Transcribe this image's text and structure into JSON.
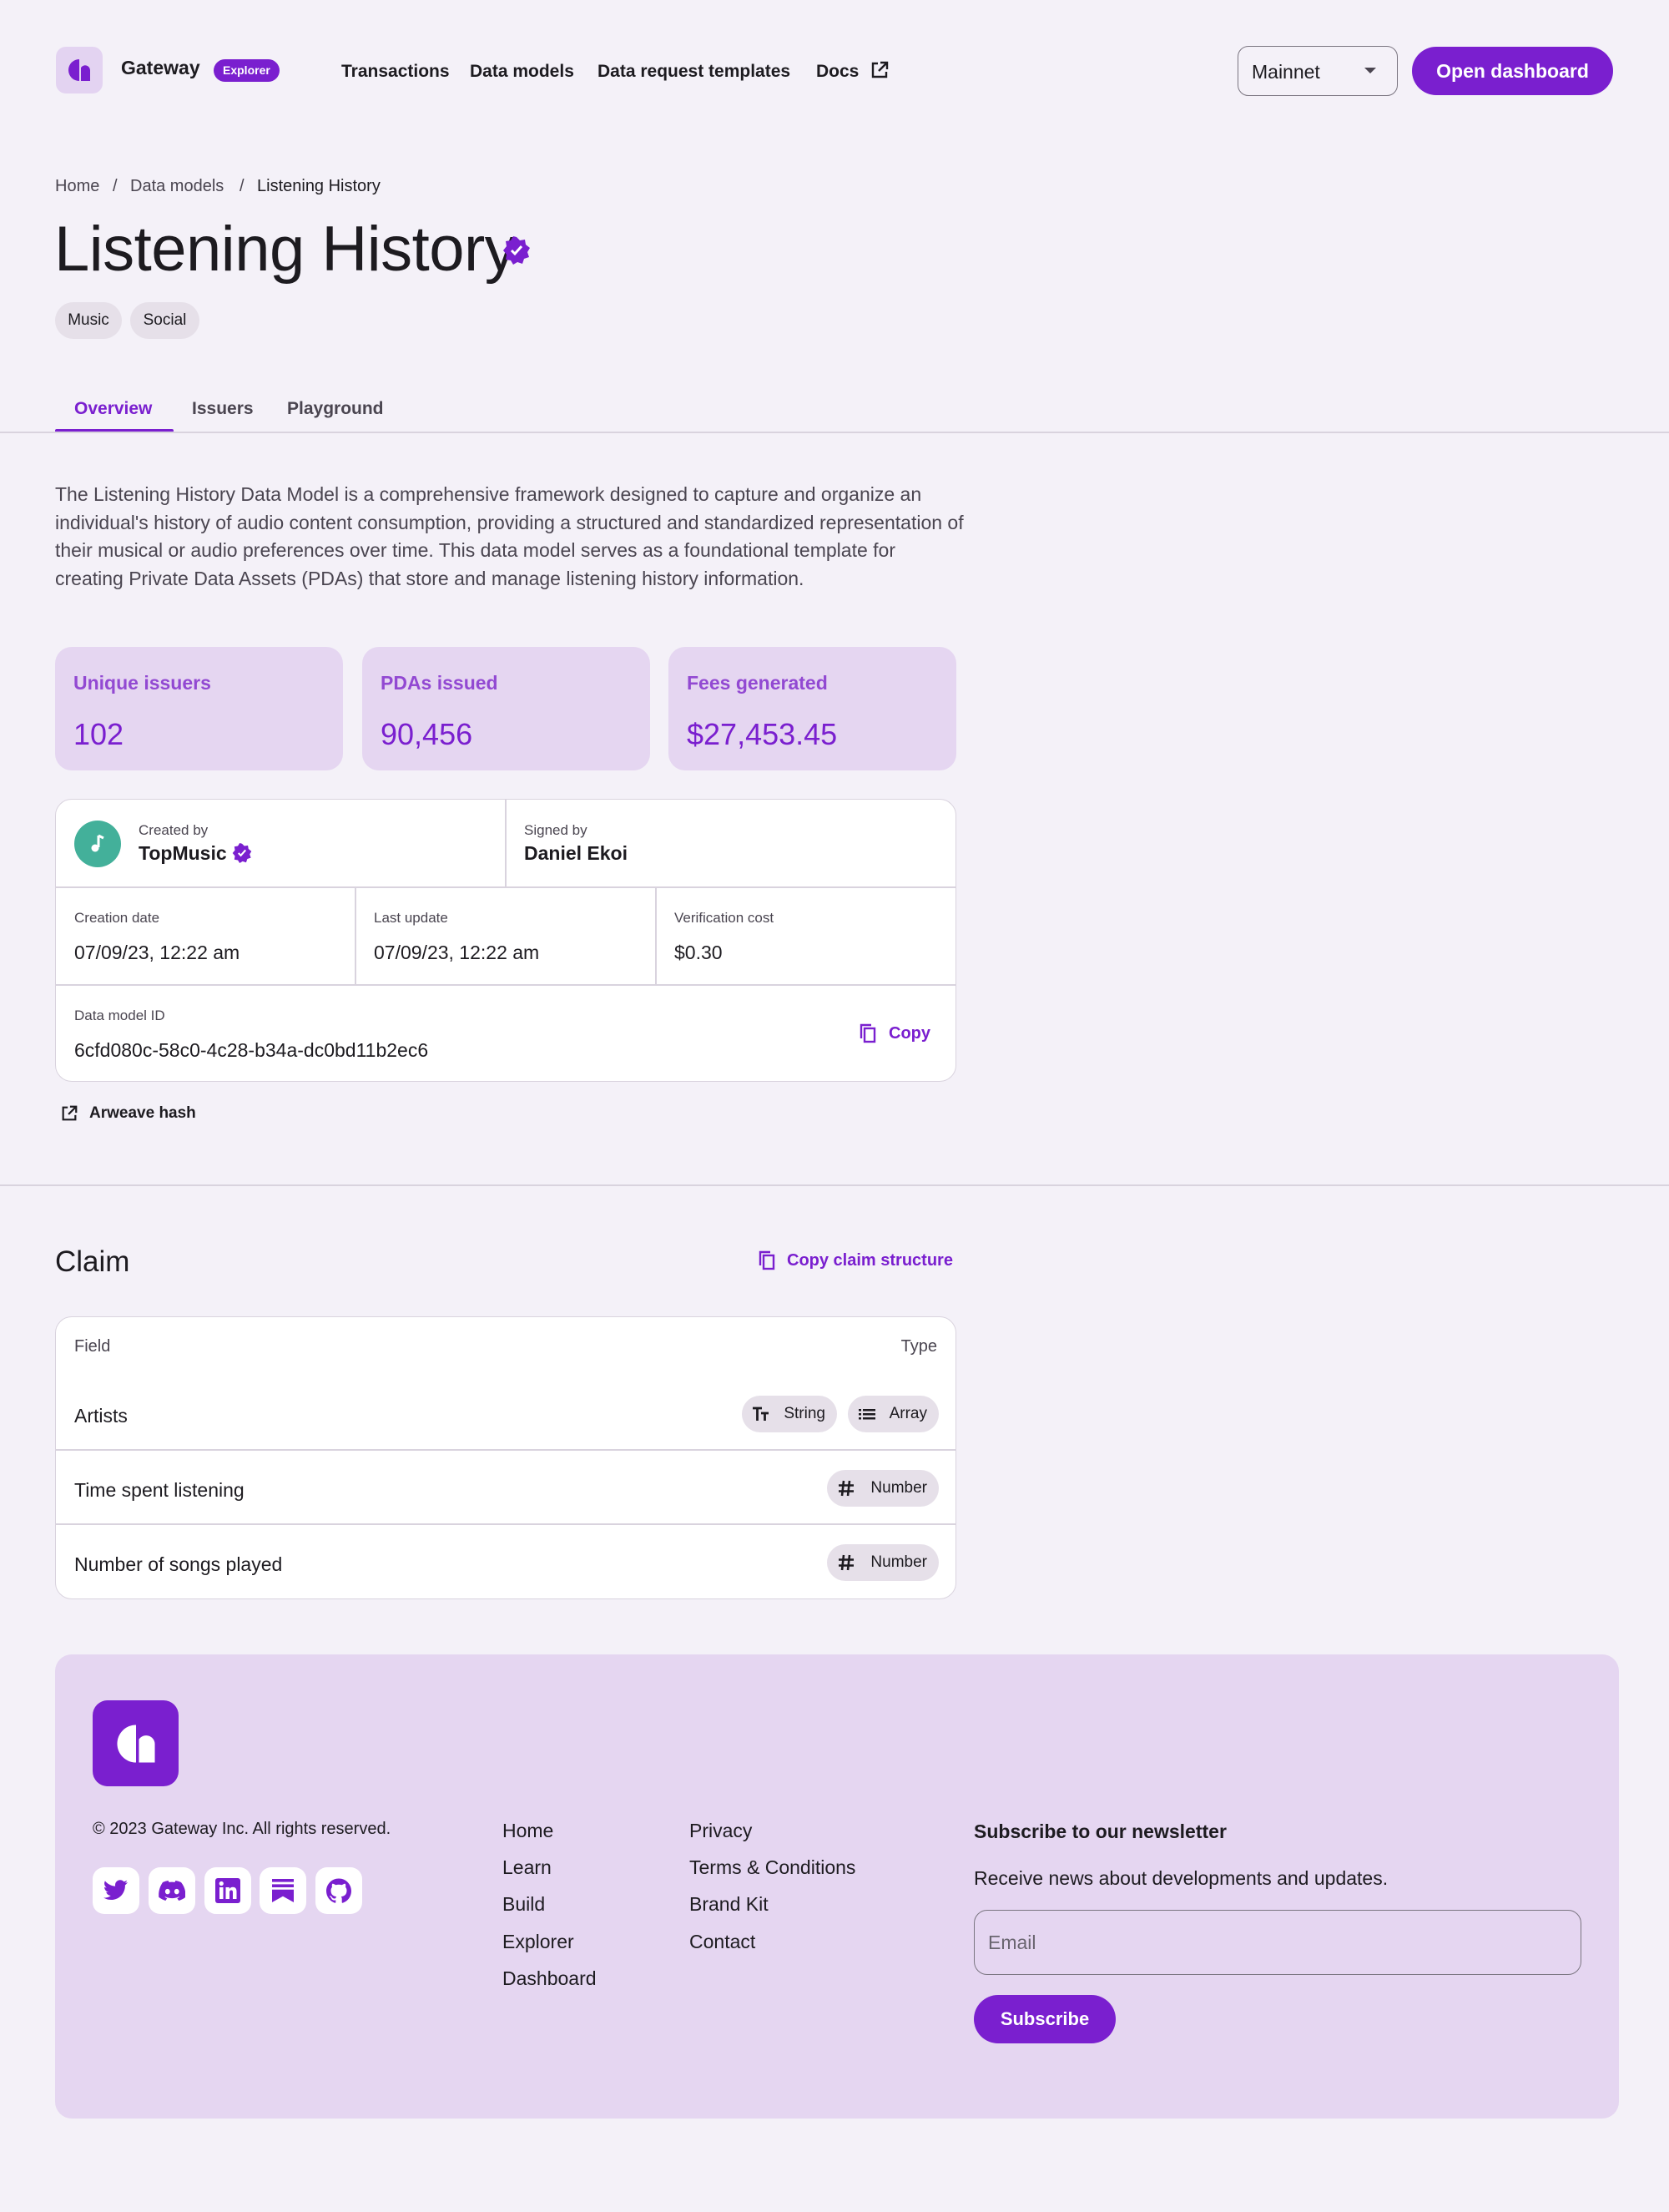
{
  "header": {
    "brand": "Gateway",
    "badge": "Explorer",
    "nav": [
      {
        "label": "Transactions"
      },
      {
        "label": "Data models"
      },
      {
        "label": "Data request templates"
      },
      {
        "label": "Docs"
      }
    ],
    "network": "Mainnet",
    "open_dashboard": "Open dashboard"
  },
  "breadcrumb": [
    "Home",
    "Data models",
    "Listening History"
  ],
  "page": {
    "title": "Listening History",
    "tags": [
      "Music",
      "Social"
    ],
    "tabs": [
      "Overview",
      "Issuers",
      "Playground"
    ],
    "description": "The Listening History Data Model is a comprehensive framework designed to capture and organize an individual's history of audio content consumption, providing a structured and standardized representation of their musical or audio preferences over time. This data model serves as a foundational template for creating Private Data Assets (PDAs) that store and manage listening history information."
  },
  "stats": [
    {
      "label": "Unique issuers",
      "value": "102"
    },
    {
      "label": "PDAs issued",
      "value": "90,456"
    },
    {
      "label": "Fees generated",
      "value": "$27,453.45"
    }
  ],
  "info": {
    "created_by_label": "Created by",
    "created_by": "TopMusic",
    "signed_by_label": "Signed by",
    "signed_by": "Daniel Ekoi",
    "creation_date_label": "Creation date",
    "creation_date": "07/09/23, 12:22 am",
    "last_update_label": "Last update",
    "last_update": "07/09/23, 12:22 am",
    "verification_cost_label": "Verification cost",
    "verification_cost": "$0.30",
    "data_model_id_label": "Data model ID",
    "data_model_id": "6cfd080c-58c0-4c28-b34a-dc0bd11b2ec6",
    "copy": "Copy",
    "arweave": "Arweave hash"
  },
  "claim": {
    "title": "Claim",
    "copy_structure": "Copy claim structure",
    "col_field": "Field",
    "col_type": "Type",
    "rows": [
      {
        "field": "Artists",
        "types": [
          "String",
          "Array"
        ]
      },
      {
        "field": "Time spent listening",
        "types": [
          "Number"
        ]
      },
      {
        "field": "Number of songs played",
        "types": [
          "Number"
        ]
      }
    ]
  },
  "footer": {
    "copyright": "© 2023 Gateway Inc. All rights reserved.",
    "links_col1": [
      "Home",
      "Learn",
      "Build",
      "Explorer",
      "Dashboard"
    ],
    "links_col2": [
      "Privacy",
      "Terms & Conditions",
      "Brand Kit",
      "Contact"
    ],
    "newsletter_title": "Subscribe to our newsletter",
    "newsletter_text": "Receive news about developments and updates.",
    "email_placeholder": "Email",
    "subscribe": "Subscribe",
    "socials": [
      "twitter-icon",
      "discord-icon",
      "linkedin-icon",
      "substack-icon",
      "github-icon"
    ]
  },
  "colors": {
    "accent": "#7a1fcf",
    "card_tint": "#e5d6f1",
    "background": "#f4f1f8",
    "avatar": "#43b09a"
  }
}
